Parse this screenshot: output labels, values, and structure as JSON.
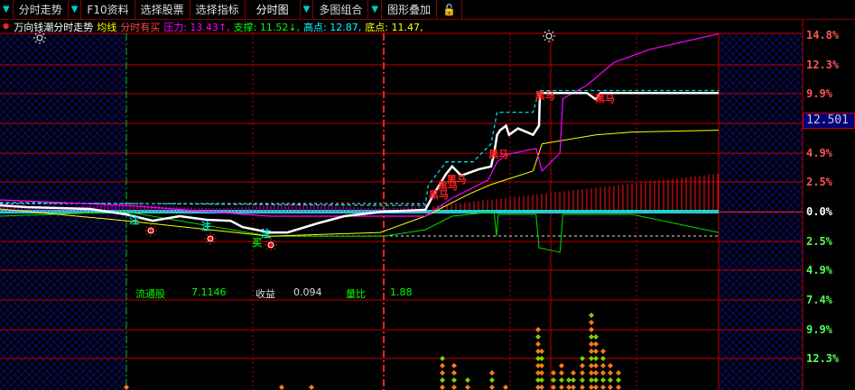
{
  "toolbar": {
    "items": [
      "分时走势",
      "F10资料",
      "选择股票",
      "选择指标",
      "分时图",
      "多图组合",
      "图形叠加"
    ]
  },
  "info": {
    "title": "万向钱潮分时走势",
    "avg": "均线",
    "signal": "分时有买",
    "pressure": "压力: 13.43↑,",
    "support": "支撑: 11.52↓,",
    "high": "高点: 12.87,",
    "low": "底点: 11.47,"
  },
  "axis": {
    "labels": [
      "14.8%",
      "12.3%",
      "9.9%",
      "7.4%",
      "4.9%",
      "2.5%",
      "0.0%",
      "2.5%",
      "4.9%",
      "7.4%",
      "9.9%",
      "12.3%"
    ],
    "values": [
      14.8,
      12.3,
      9.9,
      7.4,
      4.9,
      2.5,
      0,
      -2.5,
      -4.9,
      -7.4,
      -9.9,
      -12.3
    ],
    "current_price": "12.501"
  },
  "stats": {
    "float_label": "流通股",
    "float_value": "7.1146",
    "eps_label": "收益",
    "eps_value": "0.094",
    "vr_label": "量比",
    "vr_value": "1.88"
  },
  "signals": {
    "heima": "黑马",
    "zhu": "注",
    "mai": "买"
  },
  "colors": {
    "grid": "#c00000",
    "price": "#ffffff",
    "avg": "#ffff00",
    "magenta": "#ff00ff",
    "green": "#00dd00",
    "cyan": "#00e0e0"
  },
  "series": {
    "price": [
      [
        0,
        0.53
      ],
      [
        9,
        0.38
      ],
      [
        30,
        0.23
      ],
      [
        42,
        -0.23
      ],
      [
        51,
        -0.76
      ],
      [
        60,
        -0.38
      ],
      [
        69,
        -0.68
      ],
      [
        77,
        -0.76
      ],
      [
        81,
        -1.29
      ],
      [
        90,
        -1.74
      ],
      [
        96,
        -1.74
      ],
      [
        106,
        -0.98
      ],
      [
        115,
        -0.38
      ],
      [
        128,
        0
      ],
      [
        142,
        0.15
      ],
      [
        145,
        1.52
      ],
      [
        149,
        3.18
      ],
      [
        151,
        3.79
      ],
      [
        154,
        3.03
      ],
      [
        160,
        3.56
      ],
      [
        164,
        3.79
      ],
      [
        165,
        4.92
      ],
      [
        166,
        6.44
      ],
      [
        167,
        6.82
      ],
      [
        169,
        7.2
      ],
      [
        170,
        6.44
      ],
      [
        173,
        6.97
      ],
      [
        178,
        6.44
      ],
      [
        180,
        7.2
      ],
      [
        180.3,
        9.85
      ],
      [
        181,
        9.95
      ],
      [
        196,
        9.95
      ],
      [
        199,
        9.4
      ],
      [
        200.5,
        9.95
      ],
      [
        240,
        9.95
      ]
    ],
    "avg": [
      [
        0,
        0.23
      ],
      [
        42,
        -0.76
      ],
      [
        90,
        -2.05
      ],
      [
        127,
        -1.74
      ],
      [
        142,
        -0.38
      ],
      [
        157,
        1.52
      ],
      [
        164,
        2.27
      ],
      [
        178,
        3.41
      ],
      [
        181,
        5.68
      ],
      [
        199,
        6.44
      ],
      [
        211,
        6.67
      ],
      [
        240,
        6.82
      ]
    ],
    "magenta": [
      [
        0,
        0.98
      ],
      [
        42,
        0.53
      ],
      [
        90,
        -0.38
      ],
      [
        128,
        -0.38
      ],
      [
        142,
        -0.38
      ],
      [
        151,
        1.14
      ],
      [
        163,
        2.65
      ],
      [
        166,
        4.17
      ],
      [
        169,
        4.77
      ],
      [
        179,
        5.3
      ],
      [
        181,
        3.41
      ],
      [
        187,
        4.92
      ],
      [
        188,
        9.47
      ],
      [
        196,
        10.6
      ],
      [
        205,
        12.5
      ],
      [
        217,
        13.6
      ],
      [
        240,
        14.9
      ]
    ],
    "green": [
      [
        0,
        -0.38
      ],
      [
        42,
        0
      ],
      [
        90,
        -2.05
      ],
      [
        128,
        -2.05
      ],
      [
        142,
        -1.52
      ],
      [
        151,
        -0.38
      ],
      [
        165,
        0
      ],
      [
        165.8,
        -2.05
      ],
      [
        166.4,
        -0.23
      ],
      [
        179,
        -0.23
      ],
      [
        180,
        -3.03
      ],
      [
        187,
        -3.41
      ],
      [
        188,
        -0.23
      ],
      [
        211,
        -0.23
      ],
      [
        240,
        -1.74
      ]
    ],
    "cyan_dash": [
      [
        0,
        0.76
      ],
      [
        128,
        0.53
      ],
      [
        142,
        0.53
      ],
      [
        143,
        2.2
      ],
      [
        149,
        4.17
      ],
      [
        158,
        4.17
      ],
      [
        164,
        5.68
      ],
      [
        166,
        8.33
      ],
      [
        178,
        8.33
      ],
      [
        180,
        10.15
      ],
      [
        240,
        10.15
      ]
    ]
  },
  "heima_points": [
    [
      145,
      1.5
    ],
    [
      148,
      2.3
    ],
    [
      151,
      2.8
    ],
    [
      165,
      4.9
    ],
    [
      180.5,
      9.8
    ],
    [
      200.5,
      9.6
    ]
  ],
  "zhu_points": [
    [
      45,
      -0.6
    ],
    [
      69,
      -1.1
    ],
    [
      89,
      -1.7
    ]
  ],
  "mai_points": [
    [
      86,
      -2.5
    ]
  ]
}
